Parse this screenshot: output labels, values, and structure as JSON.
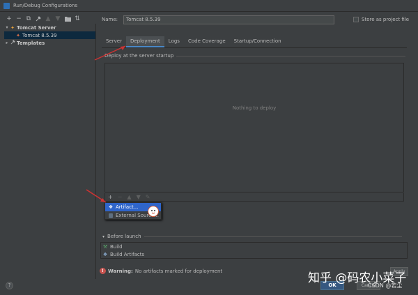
{
  "window": {
    "title": "Run/Debug Configurations"
  },
  "toolbar": {
    "add_icon": "+",
    "remove_icon": "−",
    "copy_icon": "⧉",
    "edit_icon": "🔧",
    "up_icon": "▲",
    "down_icon": "▼",
    "folder_icon": "▮",
    "sort_icon": "⇅"
  },
  "tree": {
    "group_label": "Tomcat Server",
    "config_label": "Tomcat 8.5.39",
    "templates_label": "Templates"
  },
  "form": {
    "name_label": "Name:",
    "name_value": "Tomcat 8.5.39",
    "store_label": "Store as project file"
  },
  "tabs": [
    {
      "label": "Server"
    },
    {
      "label": "Deployment"
    },
    {
      "label": "Logs"
    },
    {
      "label": "Code Coverage"
    },
    {
      "label": "Startup/Connection"
    }
  ],
  "deploy": {
    "section_label": "Deploy at the server startup",
    "empty_text": "Nothing to deploy"
  },
  "popup": {
    "items": [
      {
        "label": "Artifact..."
      },
      {
        "label": "External Source..."
      }
    ]
  },
  "before_launch": {
    "label": "Before launch",
    "items": [
      {
        "label": "Build"
      },
      {
        "label": "Build Artifacts"
      }
    ]
  },
  "warning": {
    "bold": "Warning:",
    "text": "No artifacts marked for deployment"
  },
  "buttons": {
    "help": "?",
    "ok": "OK",
    "cancel": "Cancel",
    "apply": "Apply"
  },
  "watermark": {
    "main": "知乎 @码农小菜子",
    "sub": "CSDN @若尘"
  },
  "colors": {
    "accent": "#4a88c7",
    "selection": "#2f65ca",
    "ok_button": "#365880",
    "warning": "#c75450",
    "arrow_annotation": "#cc3333"
  }
}
